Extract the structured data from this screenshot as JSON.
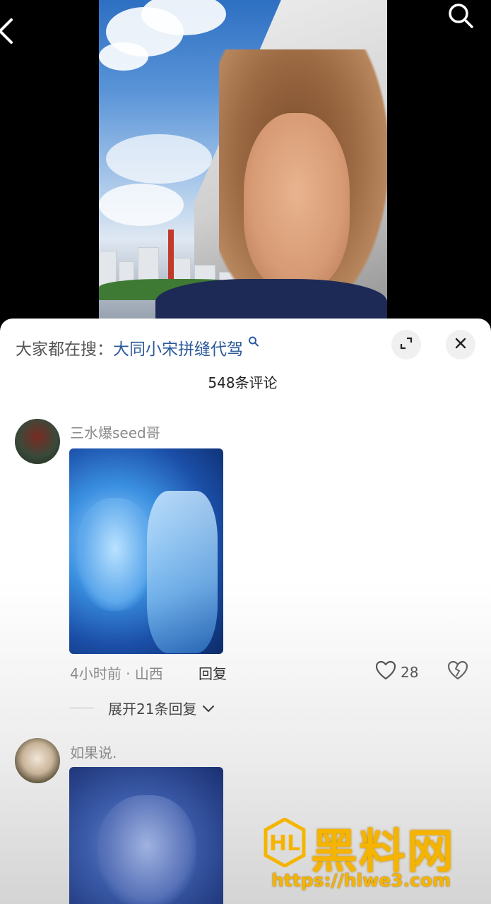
{
  "header": {
    "hot_search_prefix": "大家都在搜：",
    "hot_search_keyword": "大同小宋拼缝代驾"
  },
  "comments_count": "548条评论",
  "comments": [
    {
      "username": "三水爆seed哥",
      "time": "4小时前",
      "separator": "·",
      "location": "山西",
      "reply_label": "回复",
      "likes": "28",
      "expand_label": "展开21条回复"
    },
    {
      "username": "如果说."
    }
  ],
  "watermark": {
    "brand": "黑料网",
    "url": "https://hlwe3.com"
  },
  "colors": {
    "keyword": "#2c5a9a",
    "watermark": "#f5b400"
  }
}
